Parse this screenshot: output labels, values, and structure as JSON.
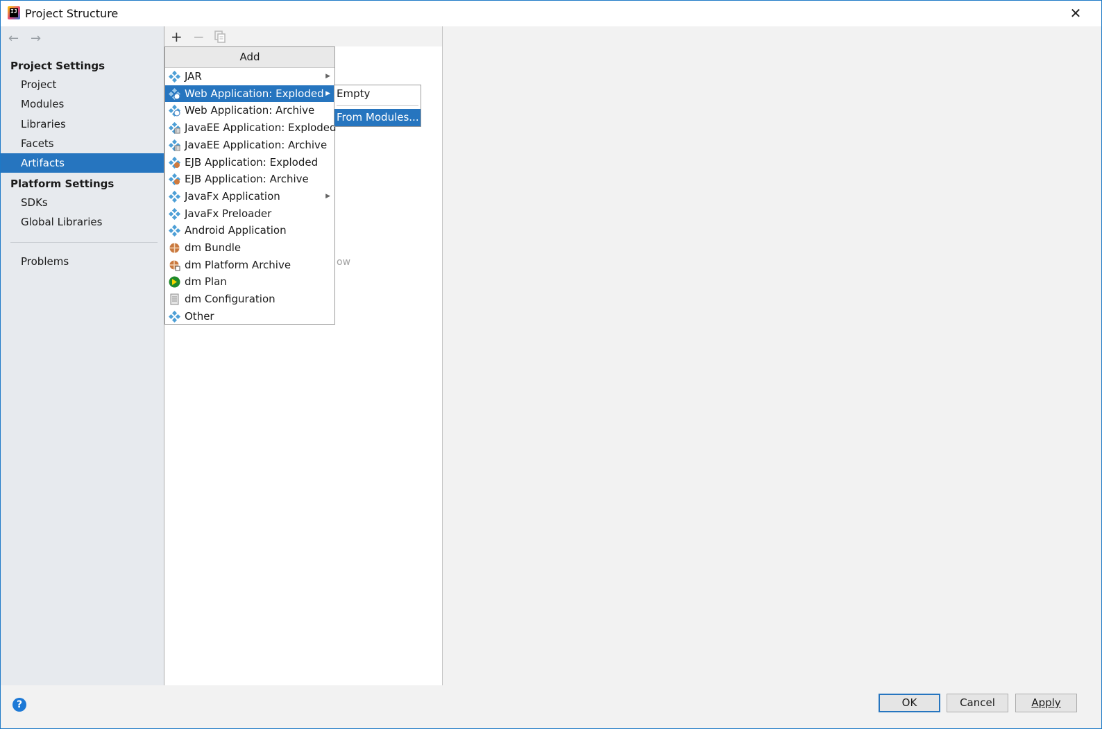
{
  "window": {
    "title": "Project Structure"
  },
  "toolbar": {
    "add": "+",
    "remove": "−"
  },
  "sidebar": {
    "sections": [
      {
        "header": "Project Settings",
        "items": [
          "Project",
          "Modules",
          "Libraries",
          "Facets",
          "Artifacts"
        ]
      },
      {
        "header": "Platform Settings",
        "items": [
          "SDKs",
          "Global Libraries"
        ]
      }
    ],
    "problems": "Problems",
    "selected": "Artifacts"
  },
  "hint_fragment": "ow",
  "add_popup": {
    "title": "Add",
    "items": [
      {
        "label": "JAR",
        "icon": "artifact-icon",
        "submenu": true
      },
      {
        "label": "Web Application: Exploded",
        "icon": "web-artifact-icon",
        "submenu": true,
        "highlighted": true
      },
      {
        "label": "Web Application: Archive",
        "icon": "web-artifact-icon"
      },
      {
        "label": "JavaEE Application: Exploded",
        "icon": "javaee-artifact-icon"
      },
      {
        "label": "JavaEE Application: Archive",
        "icon": "javaee-artifact-icon"
      },
      {
        "label": "EJB Application: Exploded",
        "icon": "ejb-artifact-icon"
      },
      {
        "label": "EJB Application: Archive",
        "icon": "ejb-artifact-icon"
      },
      {
        "label": "JavaFx Application",
        "icon": "artifact-icon",
        "submenu": true
      },
      {
        "label": "JavaFx Preloader",
        "icon": "artifact-icon"
      },
      {
        "label": "Android Application",
        "icon": "artifact-icon"
      },
      {
        "label": "dm Bundle",
        "icon": "bundle-icon"
      },
      {
        "label": "dm Platform Archive",
        "icon": "bundle-archive-icon"
      },
      {
        "label": "dm Plan",
        "icon": "plan-icon"
      },
      {
        "label": "dm Configuration",
        "icon": "configuration-file-icon"
      },
      {
        "label": "Other",
        "icon": "artifact-icon"
      }
    ]
  },
  "submenu": {
    "items": [
      {
        "label": "Empty"
      },
      {
        "label": "From Modules...",
        "highlighted": true
      }
    ]
  },
  "buttons": {
    "ok": "OK",
    "cancel": "Cancel",
    "apply": "Apply",
    "help": "?"
  },
  "colors": {
    "selection": "#2675bf",
    "sidebar_bg": "#e7eaee",
    "accent": "#1d79d6"
  }
}
